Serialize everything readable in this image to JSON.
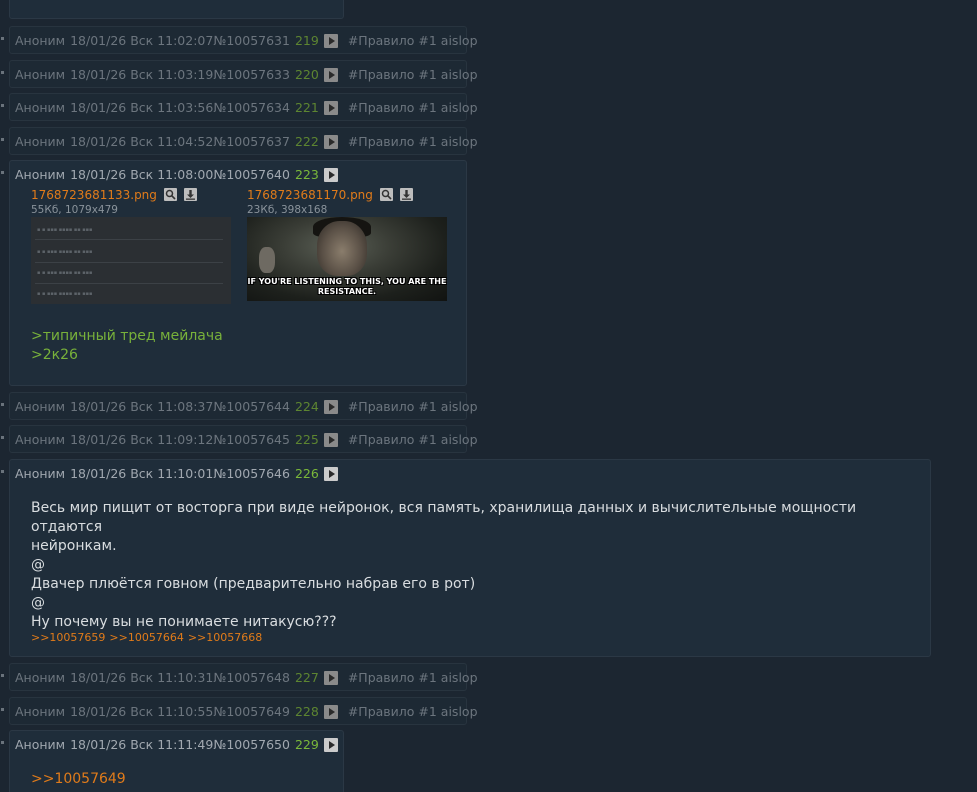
{
  "tag": "#Правило #1 aislop",
  "posts": [
    {
      "name": "Аноним",
      "date": "18/01/26 Вск 11:02:07",
      "num": "№10057631",
      "count": "219"
    },
    {
      "name": "Аноним",
      "date": "18/01/26 Вск 11:03:19",
      "num": "№10057633",
      "count": "220"
    },
    {
      "name": "Аноним",
      "date": "18/01/26 Вск 11:03:56",
      "num": "№10057634",
      "count": "221"
    },
    {
      "name": "Аноним",
      "date": "18/01/26 Вск 11:04:52",
      "num": "№10057637",
      "count": "222"
    },
    {
      "name": "Аноним",
      "date": "18/01/26 Вск 11:08:00",
      "num": "№10057640",
      "count": "223",
      "files": [
        {
          "filename": "1768723681133.png",
          "meta": "55Кб, 1079x479"
        },
        {
          "filename": "1768723681170.png",
          "meta": "23Кб, 398x168",
          "caption": "IF YOU'RE LISTENING TO THIS, YOU ARE THE RESISTANCE."
        }
      ],
      "lines": [
        ">типичный тред мейлача",
        ">2к26"
      ]
    },
    {
      "name": "Аноним",
      "date": "18/01/26 Вск 11:08:37",
      "num": "№10057644",
      "count": "224"
    },
    {
      "name": "Аноним",
      "date": "18/01/26 Вск 11:09:12",
      "num": "№10057645",
      "count": "225"
    },
    {
      "name": "Аноним",
      "date": "18/01/26 Вск 11:10:01",
      "num": "№10057646",
      "count": "226",
      "lines": [
        "Весь мир пищит от восторга при виде нейронок, вся память, хранилища данных и вычислительные мощности отдаются",
        "нейронкам.",
        "@",
        "Двачер плюётся говном (предварительно набрав его в рот)",
        "@",
        "Ну почему вы не понимаете нитакусю???"
      ],
      "replies": [
        ">>10057659",
        ">>10057664",
        ">>10057668"
      ]
    },
    {
      "name": "Аноним",
      "date": "18/01/26 Вск 11:10:31",
      "num": "№10057648",
      "count": "227"
    },
    {
      "name": "Аноним",
      "date": "18/01/26 Вск 11:10:55",
      "num": "№10057649",
      "count": "228"
    },
    {
      "name": "Аноним",
      "date": "18/01/26 Вск 11:11:49",
      "num": "№10057650",
      "count": "229",
      "lines": [
        ">>10057649"
      ]
    }
  ]
}
